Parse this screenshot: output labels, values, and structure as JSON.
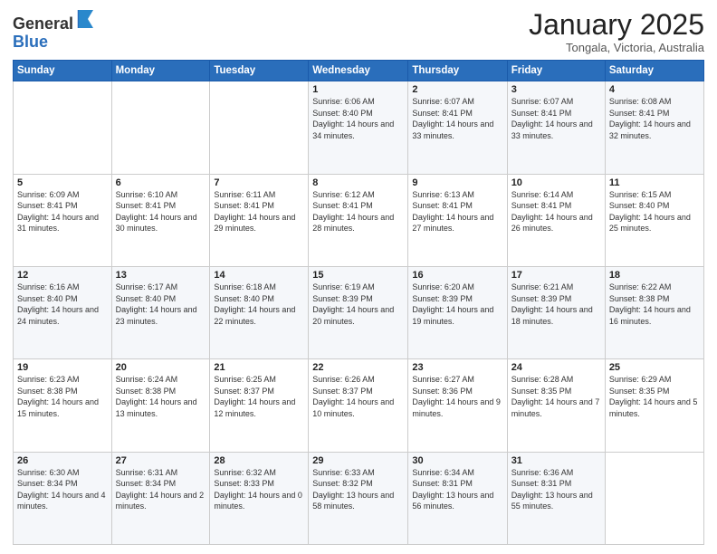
{
  "header": {
    "logo_general": "General",
    "logo_blue": "Blue",
    "month": "January 2025",
    "location": "Tongala, Victoria, Australia"
  },
  "days_of_week": [
    "Sunday",
    "Monday",
    "Tuesday",
    "Wednesday",
    "Thursday",
    "Friday",
    "Saturday"
  ],
  "weeks": [
    [
      {
        "day": "",
        "sunrise": "",
        "sunset": "",
        "daylight": ""
      },
      {
        "day": "",
        "sunrise": "",
        "sunset": "",
        "daylight": ""
      },
      {
        "day": "",
        "sunrise": "",
        "sunset": "",
        "daylight": ""
      },
      {
        "day": "1",
        "sunrise": "6:06 AM",
        "sunset": "8:40 PM",
        "daylight": "14 hours and 34 minutes."
      },
      {
        "day": "2",
        "sunrise": "6:07 AM",
        "sunset": "8:41 PM",
        "daylight": "14 hours and 33 minutes."
      },
      {
        "day": "3",
        "sunrise": "6:07 AM",
        "sunset": "8:41 PM",
        "daylight": "14 hours and 33 minutes."
      },
      {
        "day": "4",
        "sunrise": "6:08 AM",
        "sunset": "8:41 PM",
        "daylight": "14 hours and 32 minutes."
      }
    ],
    [
      {
        "day": "5",
        "sunrise": "6:09 AM",
        "sunset": "8:41 PM",
        "daylight": "14 hours and 31 minutes."
      },
      {
        "day": "6",
        "sunrise": "6:10 AM",
        "sunset": "8:41 PM",
        "daylight": "14 hours and 30 minutes."
      },
      {
        "day": "7",
        "sunrise": "6:11 AM",
        "sunset": "8:41 PM",
        "daylight": "14 hours and 29 minutes."
      },
      {
        "day": "8",
        "sunrise": "6:12 AM",
        "sunset": "8:41 PM",
        "daylight": "14 hours and 28 minutes."
      },
      {
        "day": "9",
        "sunrise": "6:13 AM",
        "sunset": "8:41 PM",
        "daylight": "14 hours and 27 minutes."
      },
      {
        "day": "10",
        "sunrise": "6:14 AM",
        "sunset": "8:41 PM",
        "daylight": "14 hours and 26 minutes."
      },
      {
        "day": "11",
        "sunrise": "6:15 AM",
        "sunset": "8:40 PM",
        "daylight": "14 hours and 25 minutes."
      }
    ],
    [
      {
        "day": "12",
        "sunrise": "6:16 AM",
        "sunset": "8:40 PM",
        "daylight": "14 hours and 24 minutes."
      },
      {
        "day": "13",
        "sunrise": "6:17 AM",
        "sunset": "8:40 PM",
        "daylight": "14 hours and 23 minutes."
      },
      {
        "day": "14",
        "sunrise": "6:18 AM",
        "sunset": "8:40 PM",
        "daylight": "14 hours and 22 minutes."
      },
      {
        "day": "15",
        "sunrise": "6:19 AM",
        "sunset": "8:39 PM",
        "daylight": "14 hours and 20 minutes."
      },
      {
        "day": "16",
        "sunrise": "6:20 AM",
        "sunset": "8:39 PM",
        "daylight": "14 hours and 19 minutes."
      },
      {
        "day": "17",
        "sunrise": "6:21 AM",
        "sunset": "8:39 PM",
        "daylight": "14 hours and 18 minutes."
      },
      {
        "day": "18",
        "sunrise": "6:22 AM",
        "sunset": "8:38 PM",
        "daylight": "14 hours and 16 minutes."
      }
    ],
    [
      {
        "day": "19",
        "sunrise": "6:23 AM",
        "sunset": "8:38 PM",
        "daylight": "14 hours and 15 minutes."
      },
      {
        "day": "20",
        "sunrise": "6:24 AM",
        "sunset": "8:38 PM",
        "daylight": "14 hours and 13 minutes."
      },
      {
        "day": "21",
        "sunrise": "6:25 AM",
        "sunset": "8:37 PM",
        "daylight": "14 hours and 12 minutes."
      },
      {
        "day": "22",
        "sunrise": "6:26 AM",
        "sunset": "8:37 PM",
        "daylight": "14 hours and 10 minutes."
      },
      {
        "day": "23",
        "sunrise": "6:27 AM",
        "sunset": "8:36 PM",
        "daylight": "14 hours and 9 minutes."
      },
      {
        "day": "24",
        "sunrise": "6:28 AM",
        "sunset": "8:35 PM",
        "daylight": "14 hours and 7 minutes."
      },
      {
        "day": "25",
        "sunrise": "6:29 AM",
        "sunset": "8:35 PM",
        "daylight": "14 hours and 5 minutes."
      }
    ],
    [
      {
        "day": "26",
        "sunrise": "6:30 AM",
        "sunset": "8:34 PM",
        "daylight": "14 hours and 4 minutes."
      },
      {
        "day": "27",
        "sunrise": "6:31 AM",
        "sunset": "8:34 PM",
        "daylight": "14 hours and 2 minutes."
      },
      {
        "day": "28",
        "sunrise": "6:32 AM",
        "sunset": "8:33 PM",
        "daylight": "14 hours and 0 minutes."
      },
      {
        "day": "29",
        "sunrise": "6:33 AM",
        "sunset": "8:32 PM",
        "daylight": "13 hours and 58 minutes."
      },
      {
        "day": "30",
        "sunrise": "6:34 AM",
        "sunset": "8:31 PM",
        "daylight": "13 hours and 56 minutes."
      },
      {
        "day": "31",
        "sunrise": "6:36 AM",
        "sunset": "8:31 PM",
        "daylight": "13 hours and 55 minutes."
      },
      {
        "day": "",
        "sunrise": "",
        "sunset": "",
        "daylight": ""
      }
    ]
  ]
}
